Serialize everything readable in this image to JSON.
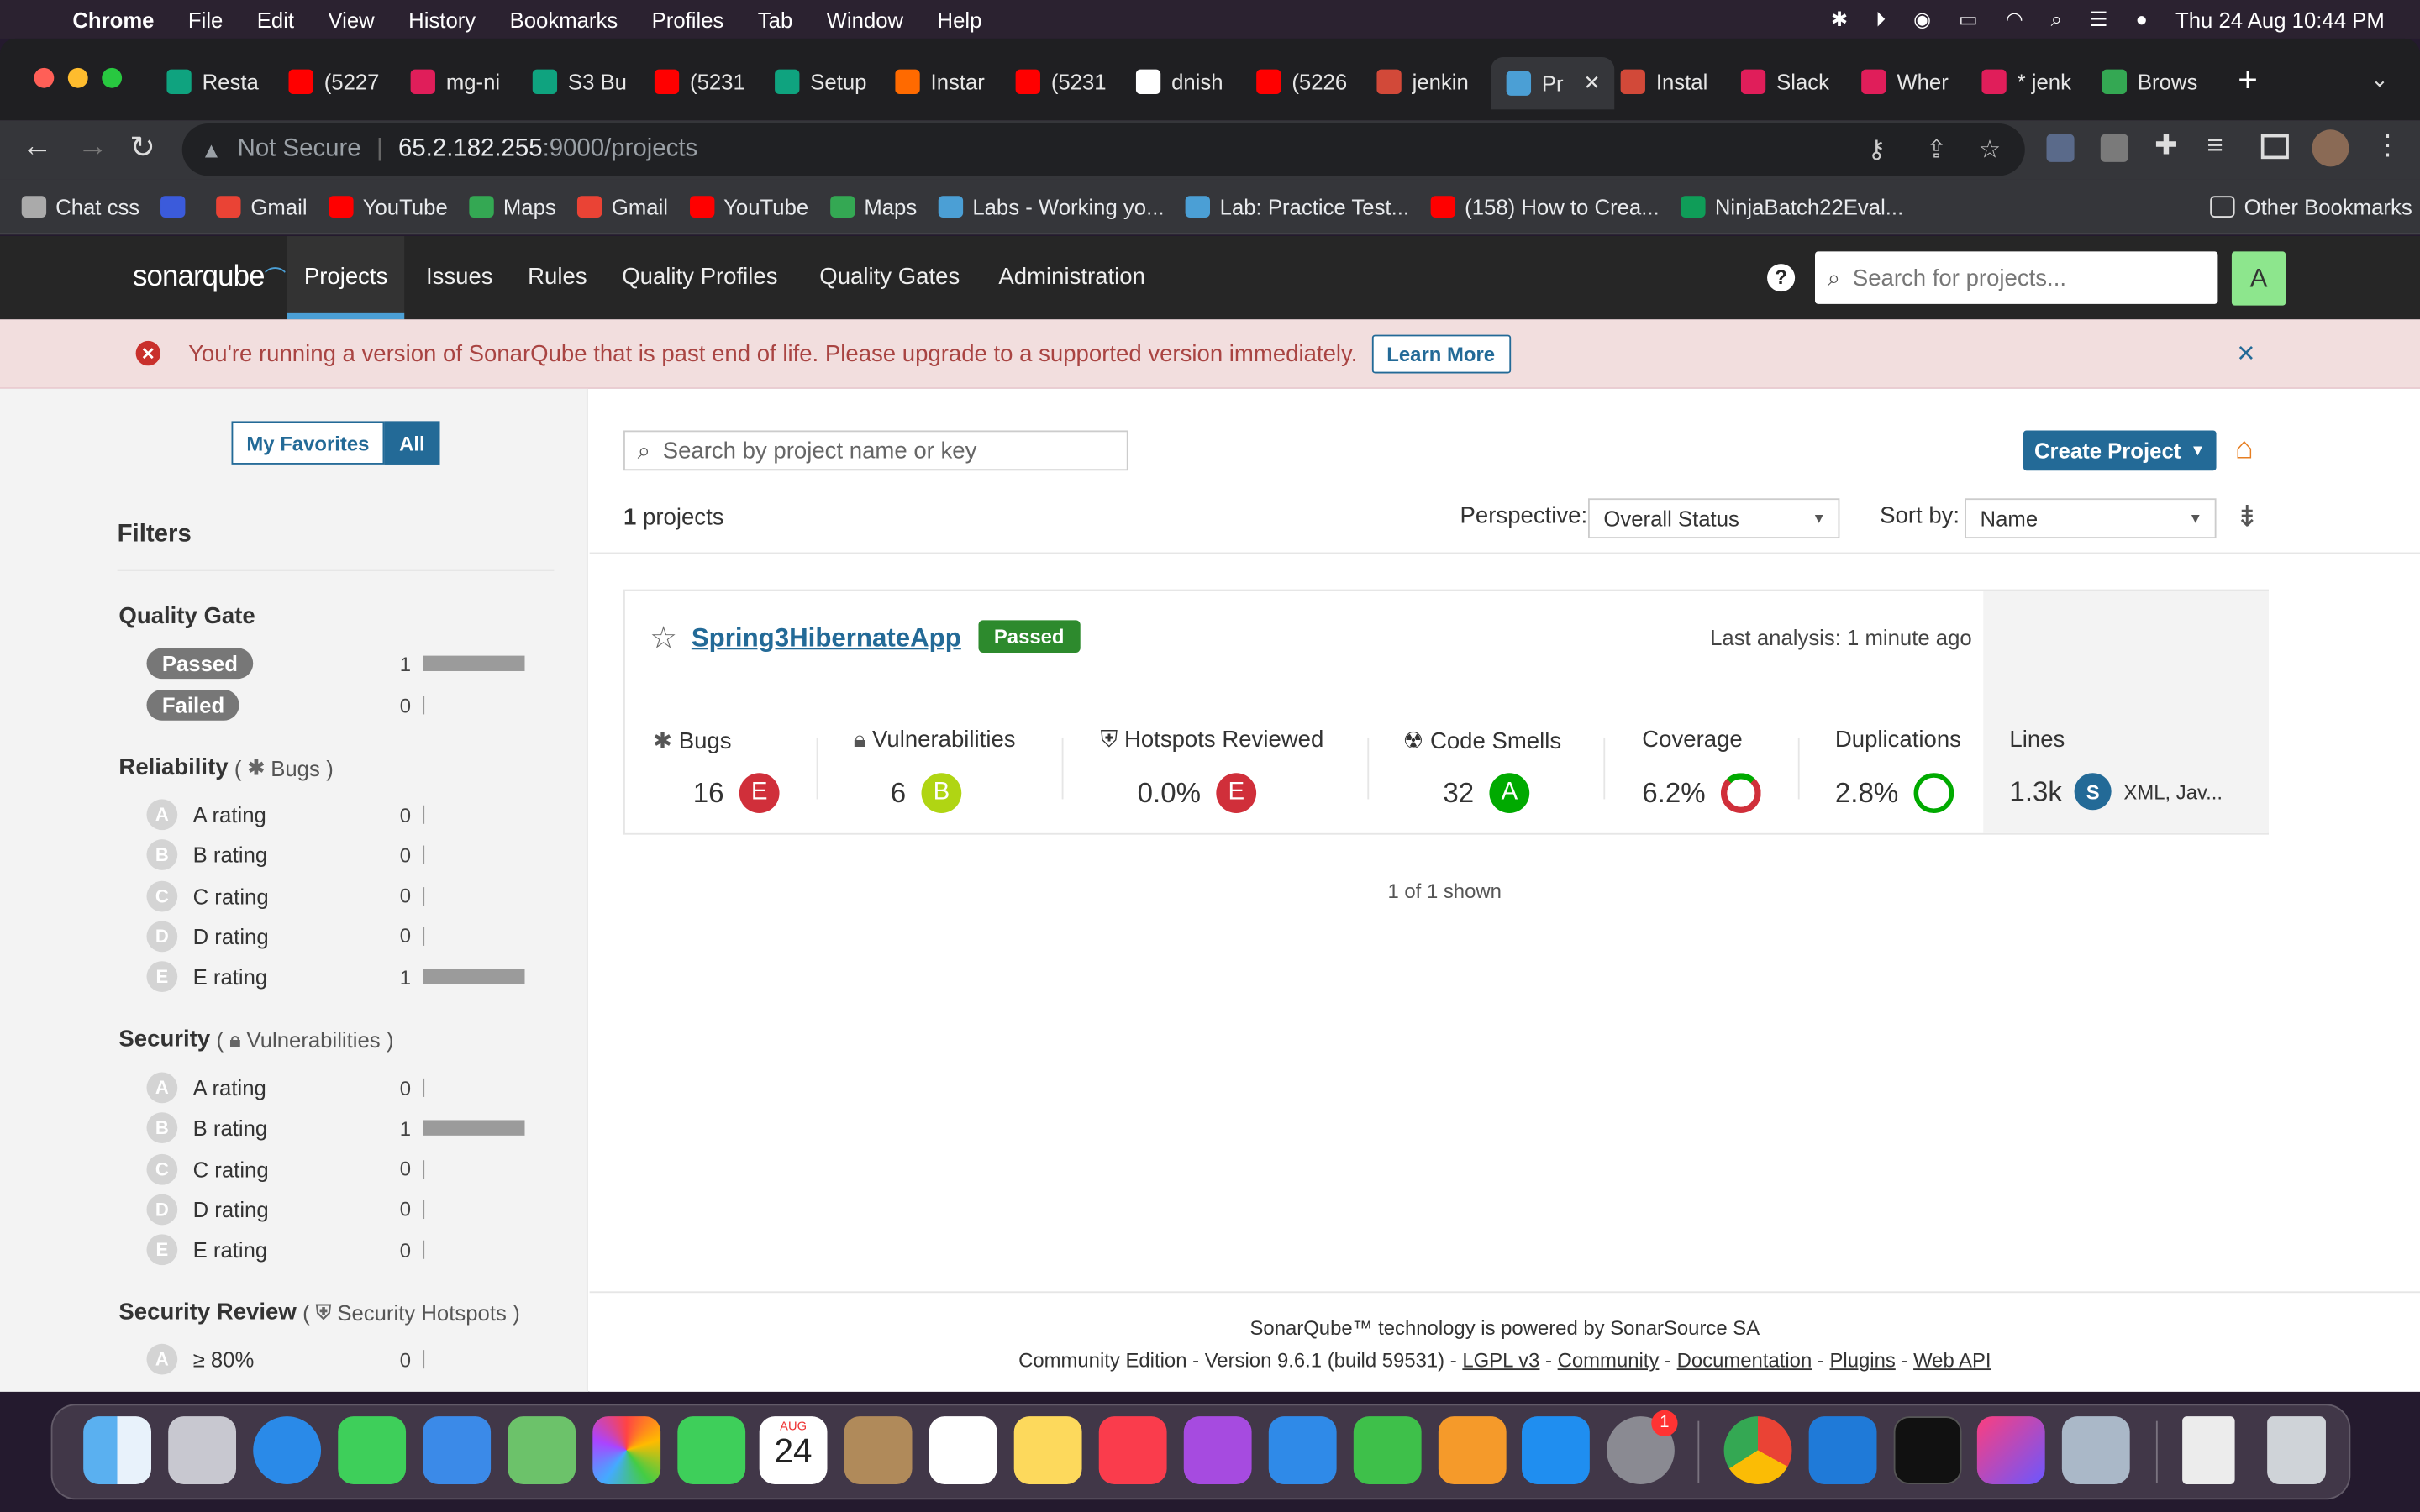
{
  "menubar": {
    "app": "Chrome",
    "items": [
      "File",
      "Edit",
      "View",
      "History",
      "Bookmarks",
      "Profiles",
      "Tab",
      "Window",
      "Help"
    ],
    "datetime": "Thu 24 Aug  10:44 PM"
  },
  "tabs": [
    {
      "label": "Resta",
      "color": "#0fa37f"
    },
    {
      "label": "(5227",
      "color": "#ff0000"
    },
    {
      "label": "mg-ni",
      "color": "#e01e5a"
    },
    {
      "label": "S3 Bu",
      "color": "#0fa37f"
    },
    {
      "label": "(5231",
      "color": "#ff0000"
    },
    {
      "label": "Setup",
      "color": "#0fa37f"
    },
    {
      "label": "Instar",
      "color": "#ff6a00"
    },
    {
      "label": "(5231",
      "color": "#ff0000"
    },
    {
      "label": "dnish",
      "color": "#ffffff"
    },
    {
      "label": "(5226",
      "color": "#ff0000"
    },
    {
      "label": "jenkin",
      "color": "#d24939"
    },
    {
      "label": "Pr",
      "color": "#4b9fd5"
    },
    {
      "label": "Instal",
      "color": "#d24939"
    },
    {
      "label": "Slack",
      "color": "#e01e5a"
    },
    {
      "label": "Wher",
      "color": "#e01e5a"
    },
    {
      "label": "* jenk",
      "color": "#e01e5a"
    },
    {
      "label": "Brows",
      "color": "#34a853"
    }
  ],
  "address": {
    "security": "Not Secure",
    "url_host": "65.2.182.255",
    "url_path": ":9000/projects"
  },
  "bookmarks": [
    {
      "label": "Chat css",
      "color": "#aaaaaa"
    },
    {
      "label": "",
      "color": "#3b5bdb"
    },
    {
      "label": "Gmail",
      "color": "#ea4335"
    },
    {
      "label": "YouTube",
      "color": "#ff0000"
    },
    {
      "label": "Maps",
      "color": "#34a853"
    },
    {
      "label": "Gmail",
      "color": "#ea4335"
    },
    {
      "label": "YouTube",
      "color": "#ff0000"
    },
    {
      "label": "Maps",
      "color": "#34a853"
    },
    {
      "label": "Labs - Working yo...",
      "color": "#4b9fd5"
    },
    {
      "label": "Lab: Practice Test...",
      "color": "#4b9fd5"
    },
    {
      "label": "(158) How to Crea...",
      "color": "#ff0000"
    },
    {
      "label": "NinjaBatch22Eval...",
      "color": "#0f9d58"
    }
  ],
  "other_bookmarks": "Other Bookmarks",
  "sonar": {
    "logo": "sonarqube",
    "nav": [
      "Projects",
      "Issues",
      "Rules",
      "Quality Profiles",
      "Quality Gates",
      "Administration"
    ],
    "search_placeholder": "Search for projects...",
    "avatar": "A",
    "banner": "You're running a version of SonarQube that is past end of life. Please upgrade to a supported version immediately.",
    "learn_more": "Learn More",
    "toggle": {
      "favorites": "My Favorites",
      "all": "All"
    },
    "filters_title": "Filters",
    "quality_gate": {
      "title": "Quality Gate",
      "passed": "Passed",
      "passed_count": "1",
      "failed": "Failed",
      "failed_count": "0"
    },
    "reliability": {
      "title": "Reliability",
      "sub": "Bugs",
      "ratings": [
        {
          "l": "A",
          "t": "A rating",
          "c": "0"
        },
        {
          "l": "B",
          "t": "B rating",
          "c": "0"
        },
        {
          "l": "C",
          "t": "C rating",
          "c": "0"
        },
        {
          "l": "D",
          "t": "D rating",
          "c": "0"
        },
        {
          "l": "E",
          "t": "E rating",
          "c": "1"
        }
      ]
    },
    "security": {
      "title": "Security",
      "sub": "Vulnerabilities",
      "ratings": [
        {
          "l": "A",
          "t": "A rating",
          "c": "0"
        },
        {
          "l": "B",
          "t": "B rating",
          "c": "1"
        },
        {
          "l": "C",
          "t": "C rating",
          "c": "0"
        },
        {
          "l": "D",
          "t": "D rating",
          "c": "0"
        },
        {
          "l": "E",
          "t": "E rating",
          "c": "0"
        }
      ]
    },
    "security_review": {
      "title": "Security Review",
      "sub": "Security Hotspots",
      "first": {
        "l": "A",
        "t": "≥ 80%",
        "c": "0"
      }
    },
    "project_search_placeholder": "Search by project name or key",
    "create_project": "Create Project",
    "count_num": "1",
    "count_label": "projects",
    "perspective_label": "Perspective:",
    "perspective_value": "Overall Status",
    "sort_label": "Sort by:",
    "sort_value": "Name",
    "project": {
      "name": "Spring3HibernateApp",
      "status": "Passed",
      "last_analysis": "Last analysis: 1 minute ago",
      "bugs": {
        "label": "Bugs",
        "value": "16",
        "rating": "E"
      },
      "vulns": {
        "label": "Vulnerabilities",
        "value": "6",
        "rating": "B"
      },
      "hotspots": {
        "label": "Hotspots Reviewed",
        "value": "0.0%",
        "rating": "E"
      },
      "smells": {
        "label": "Code Smells",
        "value": "32",
        "rating": "A"
      },
      "coverage": {
        "label": "Coverage",
        "value": "6.2%"
      },
      "dup": {
        "label": "Duplications",
        "value": "2.8%"
      },
      "lines": {
        "label": "Lines",
        "value": "1.3k",
        "size": "S",
        "langs": "XML, Jav..."
      }
    },
    "shown": "1 of 1 shown",
    "footer1": "SonarQube™ technology is powered by",
    "footer_company": "SonarSource SA",
    "footer_ver": "Community Edition - Version 9.6.1 (build 59531) -",
    "footer_links": [
      "LGPL v3",
      "Community",
      "Documentation",
      "Plugins",
      "Web API"
    ]
  },
  "dock": {
    "calendar_month": "AUG",
    "calendar_day": "24",
    "badge": "1"
  }
}
